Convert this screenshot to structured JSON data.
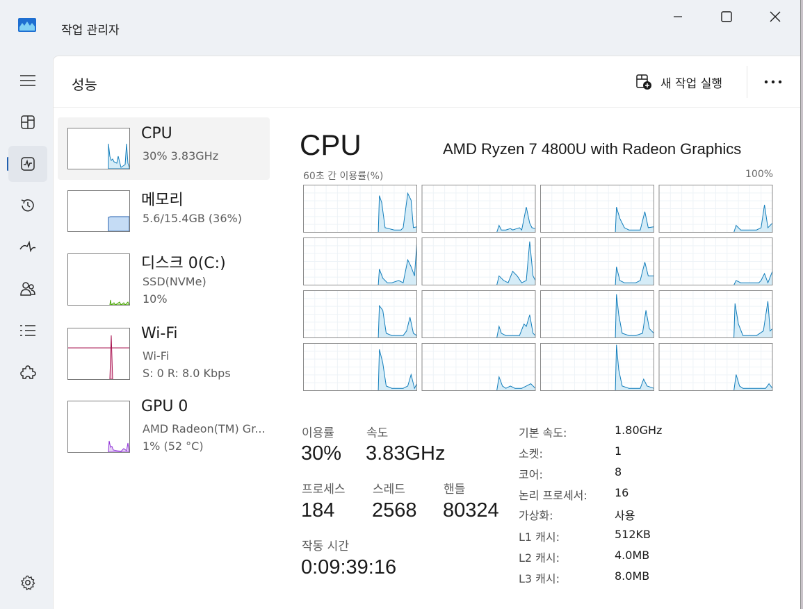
{
  "app": {
    "title": "작업 관리자"
  },
  "nav": {
    "items": [
      {
        "id": "hamburger",
        "icon": "hamburger-icon"
      },
      {
        "id": "processes",
        "icon": "processes-icon"
      },
      {
        "id": "performance",
        "icon": "performance-icon",
        "active": true
      },
      {
        "id": "app-history",
        "icon": "history-icon"
      },
      {
        "id": "startup-apps",
        "icon": "startup-icon"
      },
      {
        "id": "users",
        "icon": "users-icon"
      },
      {
        "id": "details",
        "icon": "details-list-icon"
      },
      {
        "id": "services",
        "icon": "services-puzzle-icon"
      }
    ],
    "settings_icon": "gear-icon"
  },
  "header": {
    "title": "성능",
    "run_task_label": "새 작업 실행"
  },
  "devices": [
    {
      "name": "CPU",
      "sub1": "30%  3.83GHz",
      "sub2": "",
      "color": "#117dbb",
      "selected": true
    },
    {
      "name": "메모리",
      "sub1": "5.6/15.4GB (36%)",
      "sub2": "",
      "color": "#1f5eae"
    },
    {
      "name": "디스크 0(C:)",
      "sub1": "SSD(NVMe)",
      "sub2": "10%",
      "color": "#4da60c"
    },
    {
      "name": "Wi-Fi",
      "sub1": "Wi-Fi",
      "sub2": "S:  0  R:  8.0 Kbps",
      "color": "#a7114e"
    },
    {
      "name": "GPU 0",
      "sub1": "AMD Radeon(TM) Gr...",
      "sub2": "1% (52 °C)",
      "color": "#8e2ed7"
    }
  ],
  "cpu": {
    "title": "CPU",
    "model": "AMD Ryzen 7 4800U with Radeon Graphics",
    "graph_left_label": "60초 간 이용률(%)",
    "graph_right_label": "100%",
    "line_color": "#117dbb",
    "fill_color": "#d5ecf7"
  },
  "stats": {
    "utilization_label": "이용률",
    "utilization_value": "30%",
    "speed_label": "속도",
    "speed_value": "3.83GHz",
    "processes_label": "프로세스",
    "processes_value": "184",
    "threads_label": "스레드",
    "threads_value": "2568",
    "handles_label": "핸들",
    "handles_value": "80324",
    "uptime_label": "작동 시간",
    "uptime_value": "0:09:39:16"
  },
  "specs": [
    {
      "label": "기본 속도:",
      "value": "1.80GHz"
    },
    {
      "label": "소켓:",
      "value": "1"
    },
    {
      "label": "코어:",
      "value": "8"
    },
    {
      "label": "논리 프로세서:",
      "value": "16"
    },
    {
      "label": "가상화:",
      "value": "사용"
    },
    {
      "label": "L1 캐시:",
      "value": "512KB"
    },
    {
      "label": "L2 캐시:",
      "value": "4.0MB"
    },
    {
      "label": "L3 캐시:",
      "value": "8.0MB"
    }
  ]
}
